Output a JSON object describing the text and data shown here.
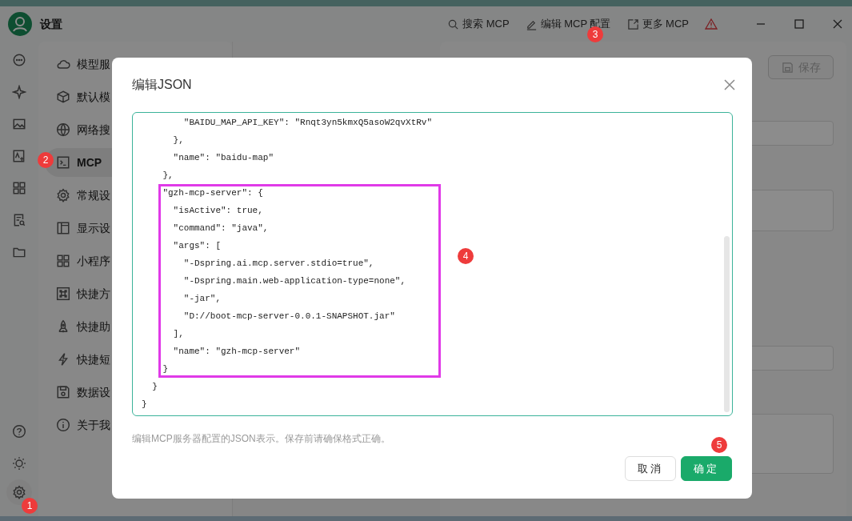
{
  "window": {
    "title": "设置"
  },
  "toolbar": [
    {
      "label": "搜索 MCP",
      "kind": "search"
    },
    {
      "label": "编辑 MCP 配置",
      "kind": "edit"
    },
    {
      "label": "更多 MCP",
      "kind": "external"
    }
  ],
  "nav": [
    {
      "label": "模型服",
      "selected": false
    },
    {
      "label": "默认模",
      "selected": false
    },
    {
      "label": "网络搜",
      "selected": false
    },
    {
      "label": "MCP",
      "selected": true
    },
    {
      "label": "常规设",
      "selected": false
    },
    {
      "label": "显示设",
      "selected": false
    },
    {
      "label": "小程序",
      "selected": false
    },
    {
      "label": "快捷方",
      "selected": false
    },
    {
      "label": "快捷助",
      "selected": false
    },
    {
      "label": "快捷短",
      "selected": false
    },
    {
      "label": "数据设",
      "selected": false
    },
    {
      "label": "关于我",
      "selected": false
    }
  ],
  "right_panel": {
    "save_button": {
      "label": "保存",
      "disabled": true
    }
  },
  "dialog": {
    "title": "编辑JSON",
    "code_lines": [
      {
        "text": "        \"BAIDU_MAP_API_KEY\": \"Rnqt3yn5kmxQ5asoW2qvXtRv\"",
        "highlighted": false
      },
      {
        "text": "      },",
        "highlighted": false
      },
      {
        "text": "      \"name\": \"baidu-map\"",
        "highlighted": false
      },
      {
        "text": "    },",
        "highlighted": false
      },
      {
        "text": "    \"gzh-mcp-server\": {",
        "highlighted": true
      },
      {
        "text": "      \"isActive\": true,",
        "highlighted": true
      },
      {
        "text": "      \"command\": \"java\",",
        "highlighted": true
      },
      {
        "text": "      \"args\": [",
        "highlighted": true
      },
      {
        "text": "        \"-Dspring.ai.mcp.server.stdio=true\",",
        "highlighted": true
      },
      {
        "text": "        \"-Dspring.main.web-application-type=none\",",
        "highlighted": true
      },
      {
        "text": "        \"-jar\",",
        "highlighted": true
      },
      {
        "text": "        \"D://boot-mcp-server-0.0.1-SNAPSHOT.jar\"",
        "highlighted": true
      },
      {
        "text": "      ],",
        "highlighted": true
      },
      {
        "text": "      \"name\": \"gzh-mcp-server\"",
        "highlighted": true
      },
      {
        "text": "    }",
        "highlighted": true
      },
      {
        "text": "  }",
        "highlighted": false
      },
      {
        "text": "}",
        "highlighted": false
      }
    ],
    "hint": "编辑MCP服务器配置的JSON表示。保存前请确保格式正确。",
    "buttons": [
      {
        "label": "取消",
        "kind": "secondary"
      },
      {
        "label": "确定",
        "kind": "primary"
      }
    ]
  },
  "annotations": [
    {
      "label": "1"
    },
    {
      "label": "2"
    },
    {
      "label": "3"
    },
    {
      "label": "4"
    },
    {
      "label": "5"
    }
  ]
}
